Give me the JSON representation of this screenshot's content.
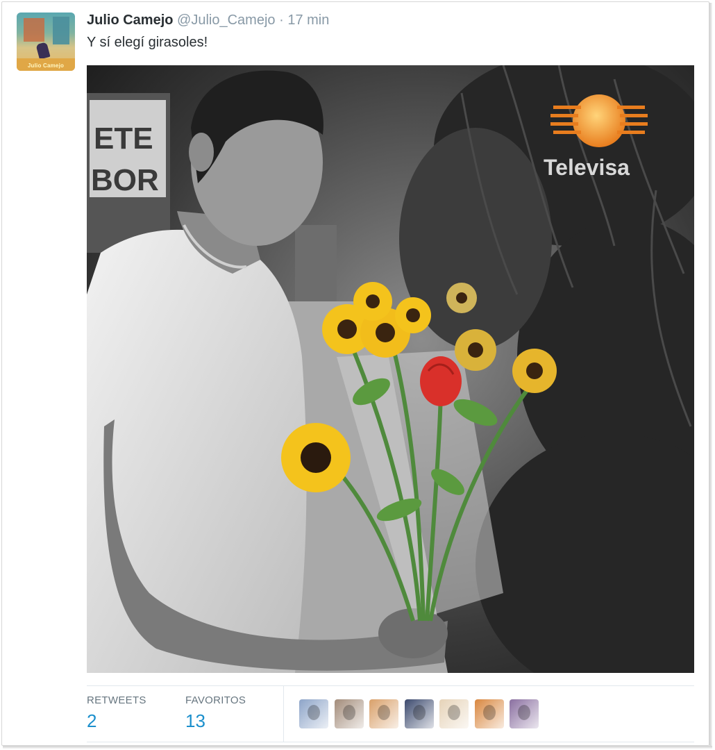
{
  "tweet": {
    "author_name": "Julio Camejo",
    "author_handle": "@Julio_Camejo",
    "separator": "·",
    "timestamp": "17 min",
    "text": "Y sí elegí girasoles!",
    "avatar_label": "Julio Camejo"
  },
  "photo": {
    "watermark_brand": "Televisa",
    "sign_text_line1": "ETE",
    "sign_text_line2": "BOR"
  },
  "stats": {
    "retweets_label": "RETWEETS",
    "retweets_count": "2",
    "favorites_label": "FAVORITOS",
    "favorites_count": "13"
  },
  "favoriters": [
    {
      "name": "favoriter-1",
      "color": "#8da4c8"
    },
    {
      "name": "favoriter-2",
      "color": "#a38c7a"
    },
    {
      "name": "favoriter-3",
      "color": "#d9a06a"
    },
    {
      "name": "favoriter-4",
      "color": "#3c4a6e"
    },
    {
      "name": "favoriter-5",
      "color": "#e6d3b8"
    },
    {
      "name": "favoriter-6",
      "color": "#d9873f"
    },
    {
      "name": "favoriter-7",
      "color": "#8a6fa0"
    }
  ],
  "colors": {
    "link_blue": "#1b8fcc",
    "muted_gray": "#8899a6",
    "sunflower_yellow": "#f4c31c",
    "rose_red": "#d9302a",
    "televisa_orange": "#e87d1e"
  }
}
